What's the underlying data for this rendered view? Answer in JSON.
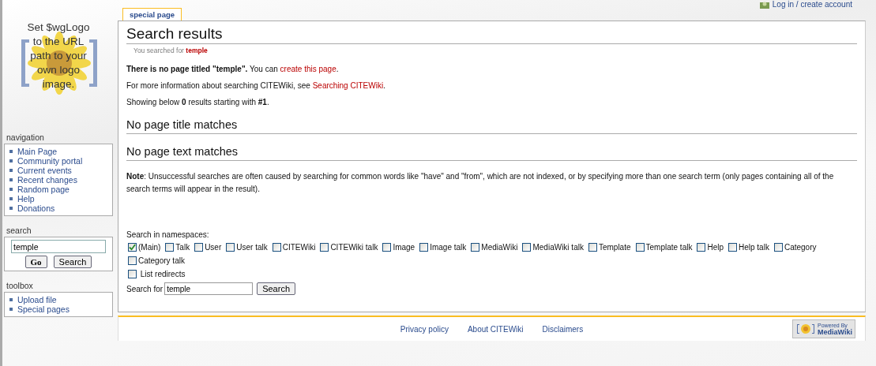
{
  "personal_links": [
    {
      "label": "Log in / create account"
    }
  ],
  "logo": {
    "text": "Set $wgLogo to the URL path to your own logo image."
  },
  "sidebar": {
    "navigation": {
      "title": "navigation",
      "items": [
        {
          "label": "Main Page"
        },
        {
          "label": "Community portal"
        },
        {
          "label": "Current events"
        },
        {
          "label": "Recent changes"
        },
        {
          "label": "Random page"
        },
        {
          "label": "Help"
        },
        {
          "label": "Donations"
        }
      ]
    },
    "search": {
      "title": "search",
      "value": "temple",
      "buttons": [
        {
          "label": "Go",
          "kind": "primary"
        },
        {
          "label": "Search",
          "kind": "plain"
        }
      ]
    },
    "toolbox": {
      "title": "toolbox",
      "items": [
        {
          "label": "Upload file"
        },
        {
          "label": "Special pages"
        }
      ]
    }
  },
  "tabs": [
    {
      "label": "special page",
      "selected": true
    }
  ],
  "content": {
    "title": "Search results",
    "subtitle_prefix": "You searched for",
    "query": "temple",
    "paragraphs": [
      {
        "parts": [
          {
            "text": "There is no page titled \"temple\".",
            "kind": "bold"
          },
          {
            "text": " You can ",
            "kind": "plain"
          },
          {
            "text": "create this page",
            "kind": "newlink"
          },
          {
            "text": ".",
            "kind": "plain"
          }
        ]
      },
      {
        "parts": [
          {
            "text": "For more information about searching CITEWiki, see ",
            "kind": "plain"
          },
          {
            "text": "Searching CITEWiki",
            "kind": "newlink"
          },
          {
            "text": ".",
            "kind": "plain"
          }
        ]
      },
      {
        "parts": [
          {
            "text": "Showing below **0** results starting with **#1**.",
            "kind": "rich"
          }
        ]
      }
    ],
    "headings": [
      "No page title matches",
      "No page text matches"
    ],
    "note": "**Note**: Unsuccessful searches are often caused by searching for common words like \"have\" and \"from\", which are not indexed, or by specifying more than one search term (only pages containing all of the search terms will appear in the result).",
    "namespaces_label": "Search in namespaces:",
    "namespaces": [
      {
        "label": "(Main)",
        "checked": true
      },
      {
        "label": "Talk",
        "checked": false
      },
      {
        "label": "User",
        "checked": false
      },
      {
        "label": "User talk",
        "checked": false
      },
      {
        "label": "CITEWiki",
        "checked": false
      },
      {
        "label": "CITEWiki talk",
        "checked": false
      },
      {
        "label": "Image",
        "checked": false
      },
      {
        "label": "Image talk",
        "checked": false
      },
      {
        "label": "MediaWiki",
        "checked": false
      },
      {
        "label": "MediaWiki talk",
        "checked": false
      },
      {
        "label": "Template",
        "checked": false
      },
      {
        "label": "Template talk",
        "checked": false
      },
      {
        "label": "Help",
        "checked": false
      },
      {
        "label": "Help talk",
        "checked": false
      },
      {
        "label": "Category",
        "checked": false
      },
      {
        "label": "Category talk",
        "checked": false
      }
    ],
    "list_redirects": {
      "label": "List redirects",
      "checked": false
    },
    "search_for_label": "Search for",
    "search_for_value": "temple",
    "search_button": "Search"
  },
  "footer": {
    "links": [
      {
        "label": "Privacy policy"
      },
      {
        "label": "About CITEWiki"
      },
      {
        "label": "Disclaimers"
      }
    ],
    "badge": {
      "small": "Powered By",
      "big": "MediaWiki"
    }
  }
}
